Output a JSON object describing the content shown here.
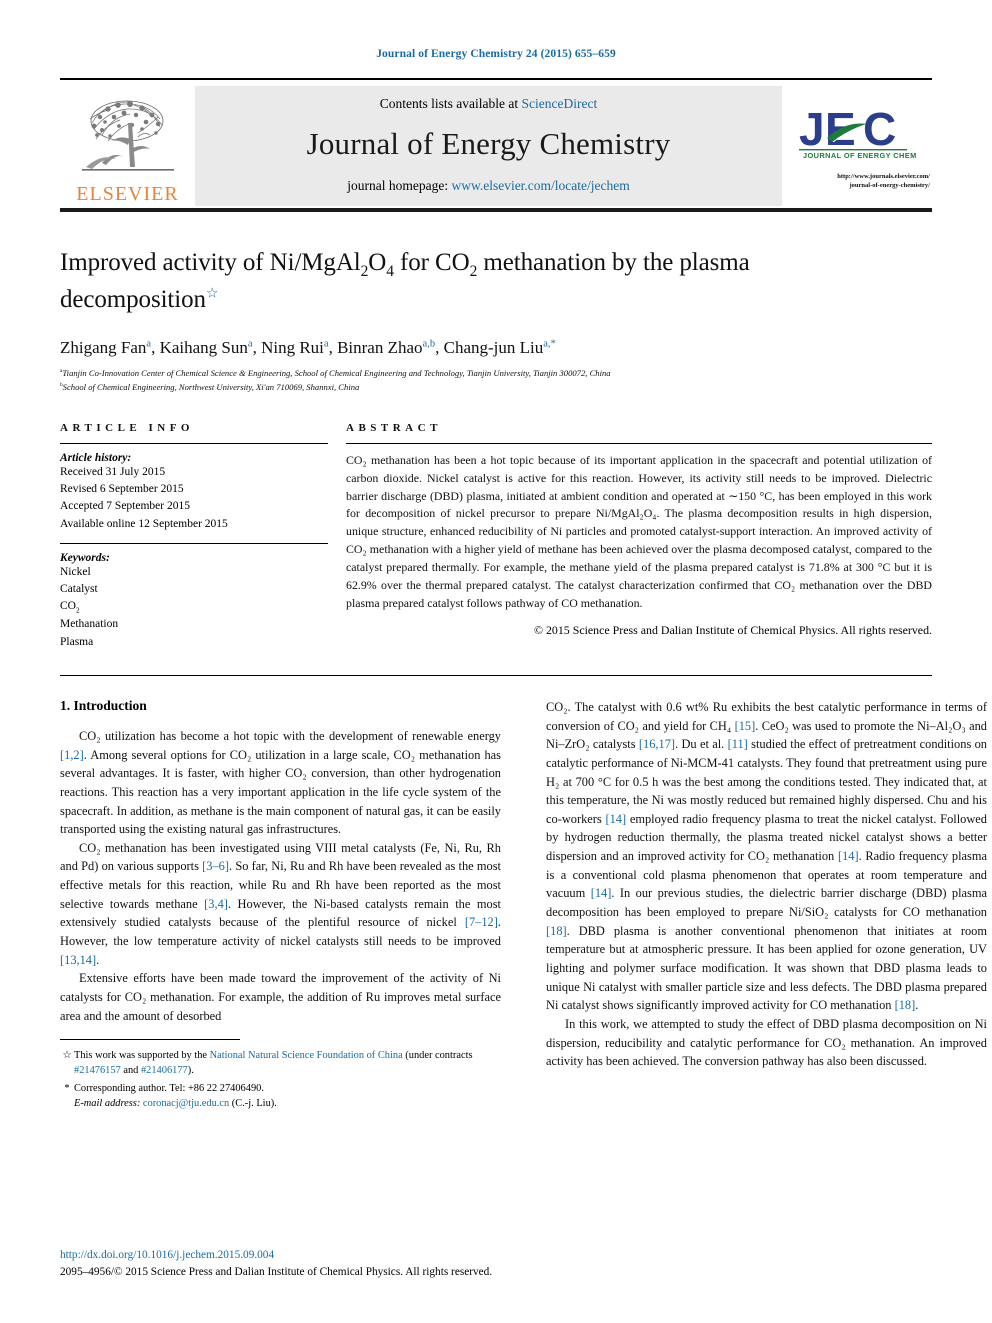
{
  "running_head": "Journal of Energy Chemistry 24 (2015) 655–659",
  "masthead": {
    "elsevier_wordmark": "ELSEVIER",
    "contents_prefix": "Contents lists available at ",
    "contents_link": "ScienceDirect",
    "journal_name": "Journal of Energy Chemistry",
    "homepage_prefix": "journal homepage: ",
    "homepage_link": "www.elsevier.com/locate/jechem",
    "jec_logo_text": "JEC",
    "jec_logo_subtitle": "JOURNAL OF ENERGY CHEMISTRY",
    "jec_url_line1": "http://www.journals.elsevier.com/",
    "jec_url_line2": "journal-of-energy-chemistry/"
  },
  "title": {
    "line1_a": "Improved activity of Ni/MgAl",
    "line1_sub1": "2",
    "line1_b": "O",
    "line1_sub2": "4",
    "line1_c": " for CO",
    "line1_sub3": "2",
    "line1_d": " methanation by the plasma",
    "line2": "decomposition",
    "star": "☆"
  },
  "authors": [
    {
      "name": "Zhigang Fan",
      "sup": "a",
      "sep": ", "
    },
    {
      "name": "Kaihang Sun",
      "sup": "a",
      "sep": ", "
    },
    {
      "name": "Ning Rui",
      "sup": "a",
      "sep": ", "
    },
    {
      "name": "Binran Zhao",
      "sup": "a,b",
      "sep": ", "
    },
    {
      "name": "Chang-jun Liu",
      "sup": "a,*",
      "sep": ""
    }
  ],
  "affiliations": [
    {
      "mark": "a",
      "text": "Tianjin Co-Innovation Center of Chemical Science & Engineering, School of Chemical Engineering and Technology, Tianjin University, Tianjin 300072, China"
    },
    {
      "mark": "b",
      "text": "School of Chemical Engineering, Northwest University, Xi'an 710069, Shannxi, China"
    }
  ],
  "article_info": {
    "heading": "ARTICLE INFO",
    "history_label": "Article history:",
    "history": [
      "Received 31 July 2015",
      "Revised 6 September 2015",
      "Accepted 7 September 2015",
      "Available online 12 September 2015"
    ],
    "keywords_label": "Keywords:",
    "keywords": [
      "Nickel",
      "Catalyst",
      "CO2",
      "Methanation",
      "Plasma"
    ]
  },
  "abstract": {
    "heading": "ABSTRACT",
    "text": "CO₂ methanation has been a hot topic because of its important application in the spacecraft and potential utilization of carbon dioxide. Nickel catalyst is active for this reaction. However, its activity still needs to be improved. Dielectric barrier discharge (DBD) plasma, initiated at ambient condition and operated at ∼150 °C, has been employed in this work for decomposition of nickel precursor to prepare Ni/MgAl₂O₄. The plasma decomposition results in high dispersion, unique structure, enhanced reducibility of Ni particles and promoted catalyst-support interaction. An improved activity of CO₂ methanation with a higher yield of methane has been achieved over the plasma decomposed catalyst, compared to the catalyst prepared thermally. For example, the methane yield of the plasma prepared catalyst is 71.8% at 300 °C but it is 62.9% over the thermal prepared catalyst. The catalyst characterization confirmed that CO₂ methanation over the DBD plasma prepared catalyst follows pathway of CO methanation.",
    "copyright": "© 2015 Science Press and Dalian Institute of Chemical Physics. All rights reserved."
  },
  "body": {
    "section1_title": "1.  Introduction",
    "left_paragraphs": [
      "CO₂ utilization has become a hot topic with the development of renewable energy [1,2]. Among several options for CO₂ utilization in a large scale, CO₂ methanation has several advantages. It is faster, with higher CO₂ conversion, than other hydrogenation reactions. This reaction has a very important application in the life cycle system of the spacecraft. In addition, as methane is the main component of natural gas, it can be easily transported using the existing natural gas infrastructures.",
      "CO₂ methanation has been investigated using VIII metal catalysts (Fe, Ni, Ru, Rh and Pd) on various supports [3–6]. So far, Ni, Ru and Rh have been revealed as the most effective metals for this reaction, while Ru and Rh have been reported as the most selective towards methane [3,4]. However, the Ni-based catalysts remain the most extensively studied catalysts because of the plentiful resource of nickel [7–12]. However, the low temperature activity of nickel catalysts still needs to be improved [13,14].",
      "Extensive efforts have been made toward the improvement of the activity of Ni catalysts for CO₂ methanation. For example, the addition of Ru improves metal surface area and the amount of desorbed"
    ],
    "right_paragraphs": [
      "CO₂. The catalyst with 0.6 wt% Ru exhibits the best catalytic performance in terms of conversion of CO₂ and yield for CH₄ [15]. CeO₂ was used to promote the Ni–Al₂O₃ and Ni–ZrO₂ catalysts [16,17]. Du et al. [11] studied the effect of pretreatment conditions on catalytic performance of Ni-MCM-41 catalysts. They found that pretreatment using pure H₂ at 700 °C for 0.5 h was the best among the conditions tested. They indicated that, at this temperature, the Ni was mostly reduced but remained highly dispersed. Chu and his co-workers [14] employed radio frequency plasma to treat the nickel catalyst. Followed by hydrogen reduction thermally, the plasma treated nickel catalyst shows a better dispersion and an improved activity for CO₂ methanation [14]. Radio frequency plasma is a conventional cold plasma phenomenon that operates at room temperature and vacuum [14]. In our previous studies, the dielectric barrier discharge (DBD) plasma decomposition has been employed to prepare Ni/SiO₂ catalysts for CO methanation [18]. DBD plasma is another conventional phenomenon that initiates at room temperature but at atmospheric pressure. It has been applied for ozone generation, UV lighting and polymer surface modification. It was shown that DBD plasma leads to unique Ni catalyst with smaller particle size and less defects. The DBD plasma prepared Ni catalyst shows significantly improved activity for CO methanation [18].",
      "In this work, we attempted to study the effect of DBD plasma decomposition on Ni dispersion, reducibility and catalytic performance for CO₂ methanation. An improved activity has been achieved. The conversion pathway has also been discussed."
    ]
  },
  "footnotes": [
    {
      "mark": "☆",
      "pre": "This work was supported by the ",
      "link": "National Natural Science Foundation of China",
      "mid": " (under contracts ",
      "grant1": "#21476157",
      "between": " and ",
      "grant2": "#21406177",
      "post": ")."
    },
    {
      "mark": "*",
      "text": "Corresponding author. Tel: +86 22 27406490.",
      "email_label": "E-mail address:",
      "email": "coronacj@tju.edu.cn",
      "email_suffix": " (C.-j. Liu)."
    }
  ],
  "footer": {
    "doi": "http://dx.doi.org/10.1016/j.jechem.2015.09.004",
    "issn_line": "2095–4956/© 2015 Science Press and Dalian Institute of Chemical Physics. All rights reserved."
  },
  "colors": {
    "link": "#1a6ba0",
    "elsevier_orange": "#E8833A",
    "jec_blue": "#2B3E8C",
    "jec_green": "#1F7A3D",
    "masthead_grey": "#eaeaea"
  }
}
